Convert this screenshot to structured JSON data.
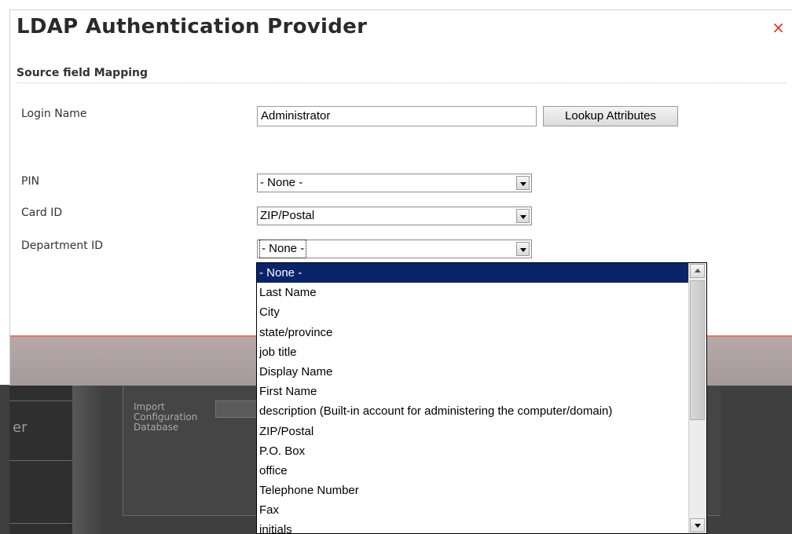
{
  "background_app": {
    "side_text": "er",
    "import_label": "Import Configuration Database"
  },
  "dialog": {
    "title": "LDAP Authentication Provider",
    "close_icon": "close-icon",
    "close_label": "×",
    "section_title": "Source field Mapping",
    "login_name": {
      "label": "Login Name",
      "value": "Administrator"
    },
    "lookup_button": "Lookup Attributes",
    "pin": {
      "label": "PIN",
      "value": "- None -"
    },
    "card_id": {
      "label": "Card ID",
      "value": "ZIP/Postal"
    },
    "department_id": {
      "label": "Department ID",
      "value": "- None -"
    }
  },
  "dropdown": {
    "selected_index": 0,
    "options": [
      "- None -",
      "Last Name",
      "City",
      "state/province",
      "job title",
      "Display Name",
      "First Name",
      "description (Built-in account for administering the computer/domain)",
      "ZIP/Postal",
      "P.O. Box",
      "office",
      "Telephone Number",
      "Fax",
      "initials"
    ]
  },
  "colors": {
    "selection": "#0a246a",
    "close": "#e0301e",
    "footer_line": "#e07a6a"
  }
}
